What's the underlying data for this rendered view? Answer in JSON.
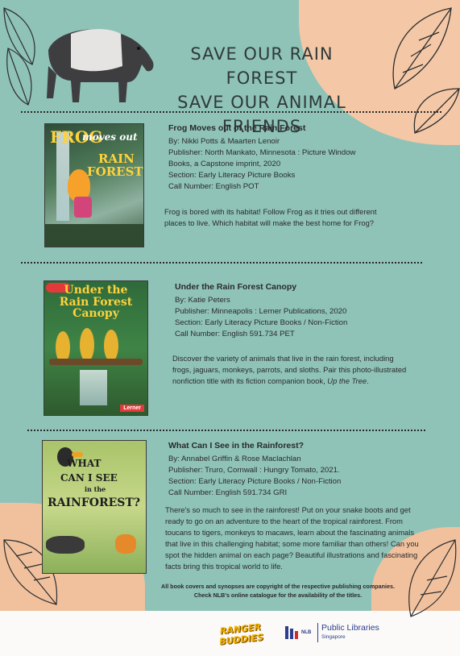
{
  "header": {
    "line1": "SAVE OUR RAIN FOREST",
    "line2": "SAVE OUR ANIMAL FRIENDS"
  },
  "books": [
    {
      "cover_title_1": "FROG",
      "cover_title_2": "moves out",
      "cover_title_3": "RAIN",
      "cover_title_4": "FOREST",
      "title": "Frog Moves out of the Rain Forest",
      "by": "By: Nikki Potts & Maarten Lenoir",
      "publisher": "Publisher: North Mankato, Minnesota : Picture Window Books, a Capstone imprint, 2020",
      "section": "Section: Early Literacy Picture Books",
      "call_number": "Call Number: English POT",
      "synopsis": "Frog is bored with its habitat! Follow Frog as it tries out different places to live. Which habitat will make the best home for Frog?"
    },
    {
      "cover_title": "Under the Rain Forest Canopy",
      "cover_badge": "Lerner",
      "title": "Under the Rain Forest Canopy",
      "by": "By: Katie Peters",
      "publisher": "Publisher: Minneapolis : Lerner Publications, 2020",
      "section": "Section: Early Literacy Picture Books / Non-Fiction",
      "call_number": "Call Number: English 591.734 PET",
      "synopsis_a": "Discover the variety of animals that live in the rain forest, including frogs, jaguars, monkeys, parrots, and sloths. Pair this photo-illustrated nonfiction title with its fiction companion book, ",
      "synopsis_italic": "Up the Tree",
      "synopsis_b": "."
    },
    {
      "cover_title_1": "WHAT",
      "cover_title_2": "CAN I SEE",
      "cover_title_3": "in the",
      "cover_title_4": "RAINFOREST?",
      "title": "What Can I See in the Rainforest?",
      "by": "By: Annabel Griffin & Rose Maclachlan",
      "publisher": "Publisher: Truro, Cornwall : Hungry Tomato, 2021.",
      "section": "Section: Early Literacy Picture Books / Non-Fiction",
      "call_number": "Call Number: English 591.734 GRI",
      "synopsis": "There's so much to see in the rainforest! Put on your snake boots and get ready to go on an adventure to the heart of the tropical rainforest. From toucans to tigers, monkeys to macaws, learn about the fascinating animals that live in this challenging habitat; some more familiar than others! Can you spot the hidden animal on each page? Beautiful illustrations and fascinating facts bring this tropical world to life."
    }
  ],
  "footer": {
    "disclaimer_1": "All book covers and synopses are copyright of the respective publishing companies.",
    "disclaimer_2": "Check NLB's online catalogue for the availability of the titles.",
    "ranger_logo": "RANGER BUDDIES",
    "nlb_abbr": "NLB",
    "nlb_name": "Public Libraries",
    "nlb_country": "Singapore"
  },
  "colors": {
    "background": "#8fc3b8",
    "peach": "#f4c8a6",
    "text": "#2a2a2a"
  }
}
